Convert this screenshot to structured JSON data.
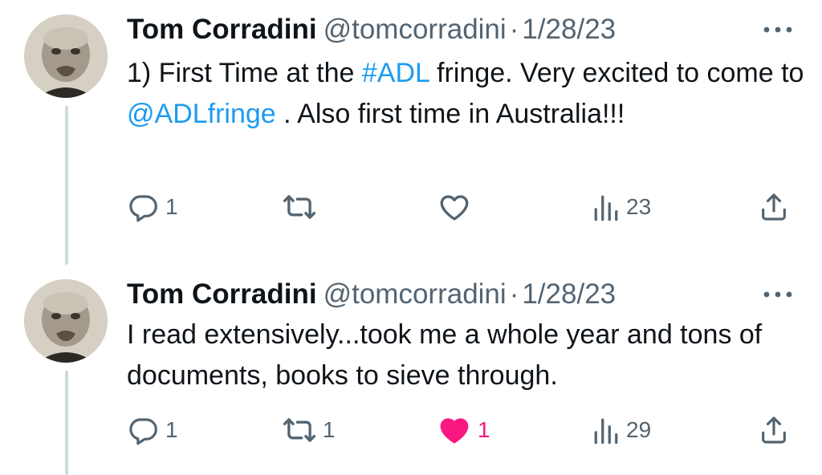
{
  "colors": {
    "text": "#0f1419",
    "secondary": "#536471",
    "link": "#1d9bf0",
    "like_active": "#f91880",
    "thread_line": "#cfd9de"
  },
  "icons": {
    "more": "more-horizontal-icon",
    "reply": "reply-icon",
    "retweet": "retweet-icon",
    "like": "heart-icon",
    "views": "views-icon",
    "share": "share-icon"
  },
  "tweets": [
    {
      "author": {
        "name": "Tom Corradini",
        "handle": "@tomcorradini"
      },
      "separator": "·",
      "date": "1/28/23",
      "text": {
        "p1": "1) First Time at the ",
        "hashtag": "#ADL",
        "p2": " fringe. Very excited to come to ",
        "mention": "@ADLfringe",
        "p3": " . Also first time in Australia!!!"
      },
      "stats": {
        "replies": "1",
        "retweets": "",
        "likes": "",
        "views": "23"
      },
      "liked": false
    },
    {
      "author": {
        "name": "Tom Corradini",
        "handle": "@tomcorradini"
      },
      "separator": "·",
      "date": "1/28/23",
      "text": {
        "p1": "I read extensively...took me a whole year and tons of documents, books to sieve through."
      },
      "stats": {
        "replies": "1",
        "retweets": "1",
        "likes": "1",
        "views": "29"
      },
      "liked": true
    }
  ]
}
